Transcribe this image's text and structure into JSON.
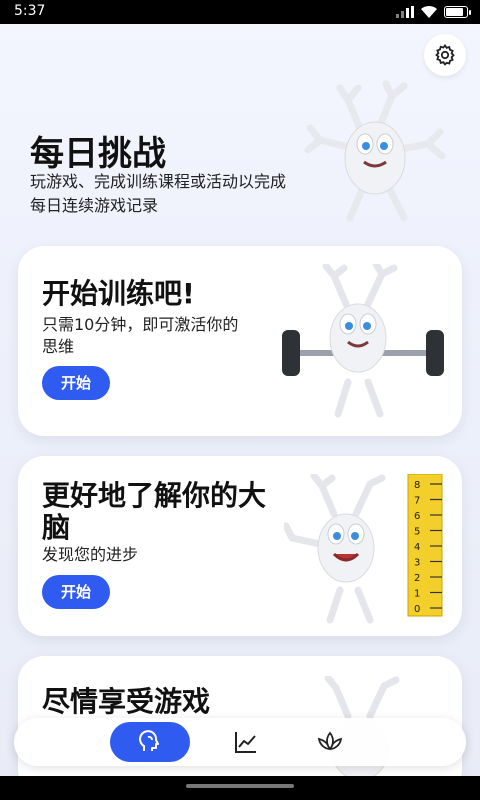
{
  "status_bar": {
    "time": "5:37",
    "battery_level": 0.9
  },
  "header": {
    "settings_icon": "gear-icon",
    "title": "每日挑战",
    "description": "玩游戏、完成训练课程或活动以完成每日连续游戏记录"
  },
  "cards": [
    {
      "title": "开始训练吧!",
      "description": "只需10分钟，即可激活你的思维",
      "button_label": "开始",
      "illustration": "neuron-weightlifting"
    },
    {
      "title": "更好地了解你的大脑",
      "description": "发现您的进步",
      "button_label": "开始",
      "illustration": "neuron-ruler",
      "ruler_marks": [
        "8",
        "7",
        "6",
        "5",
        "4",
        "3",
        "2",
        "1",
        "0"
      ]
    },
    {
      "title": "尽情享受游戏",
      "illustration": "neuron-partial"
    }
  ],
  "bottom_nav": {
    "items": [
      {
        "icon": "brain-icon",
        "active": true
      },
      {
        "icon": "chart-icon",
        "active": false
      },
      {
        "icon": "lotus-icon",
        "active": false
      }
    ],
    "accent": "#2f5bf0"
  }
}
